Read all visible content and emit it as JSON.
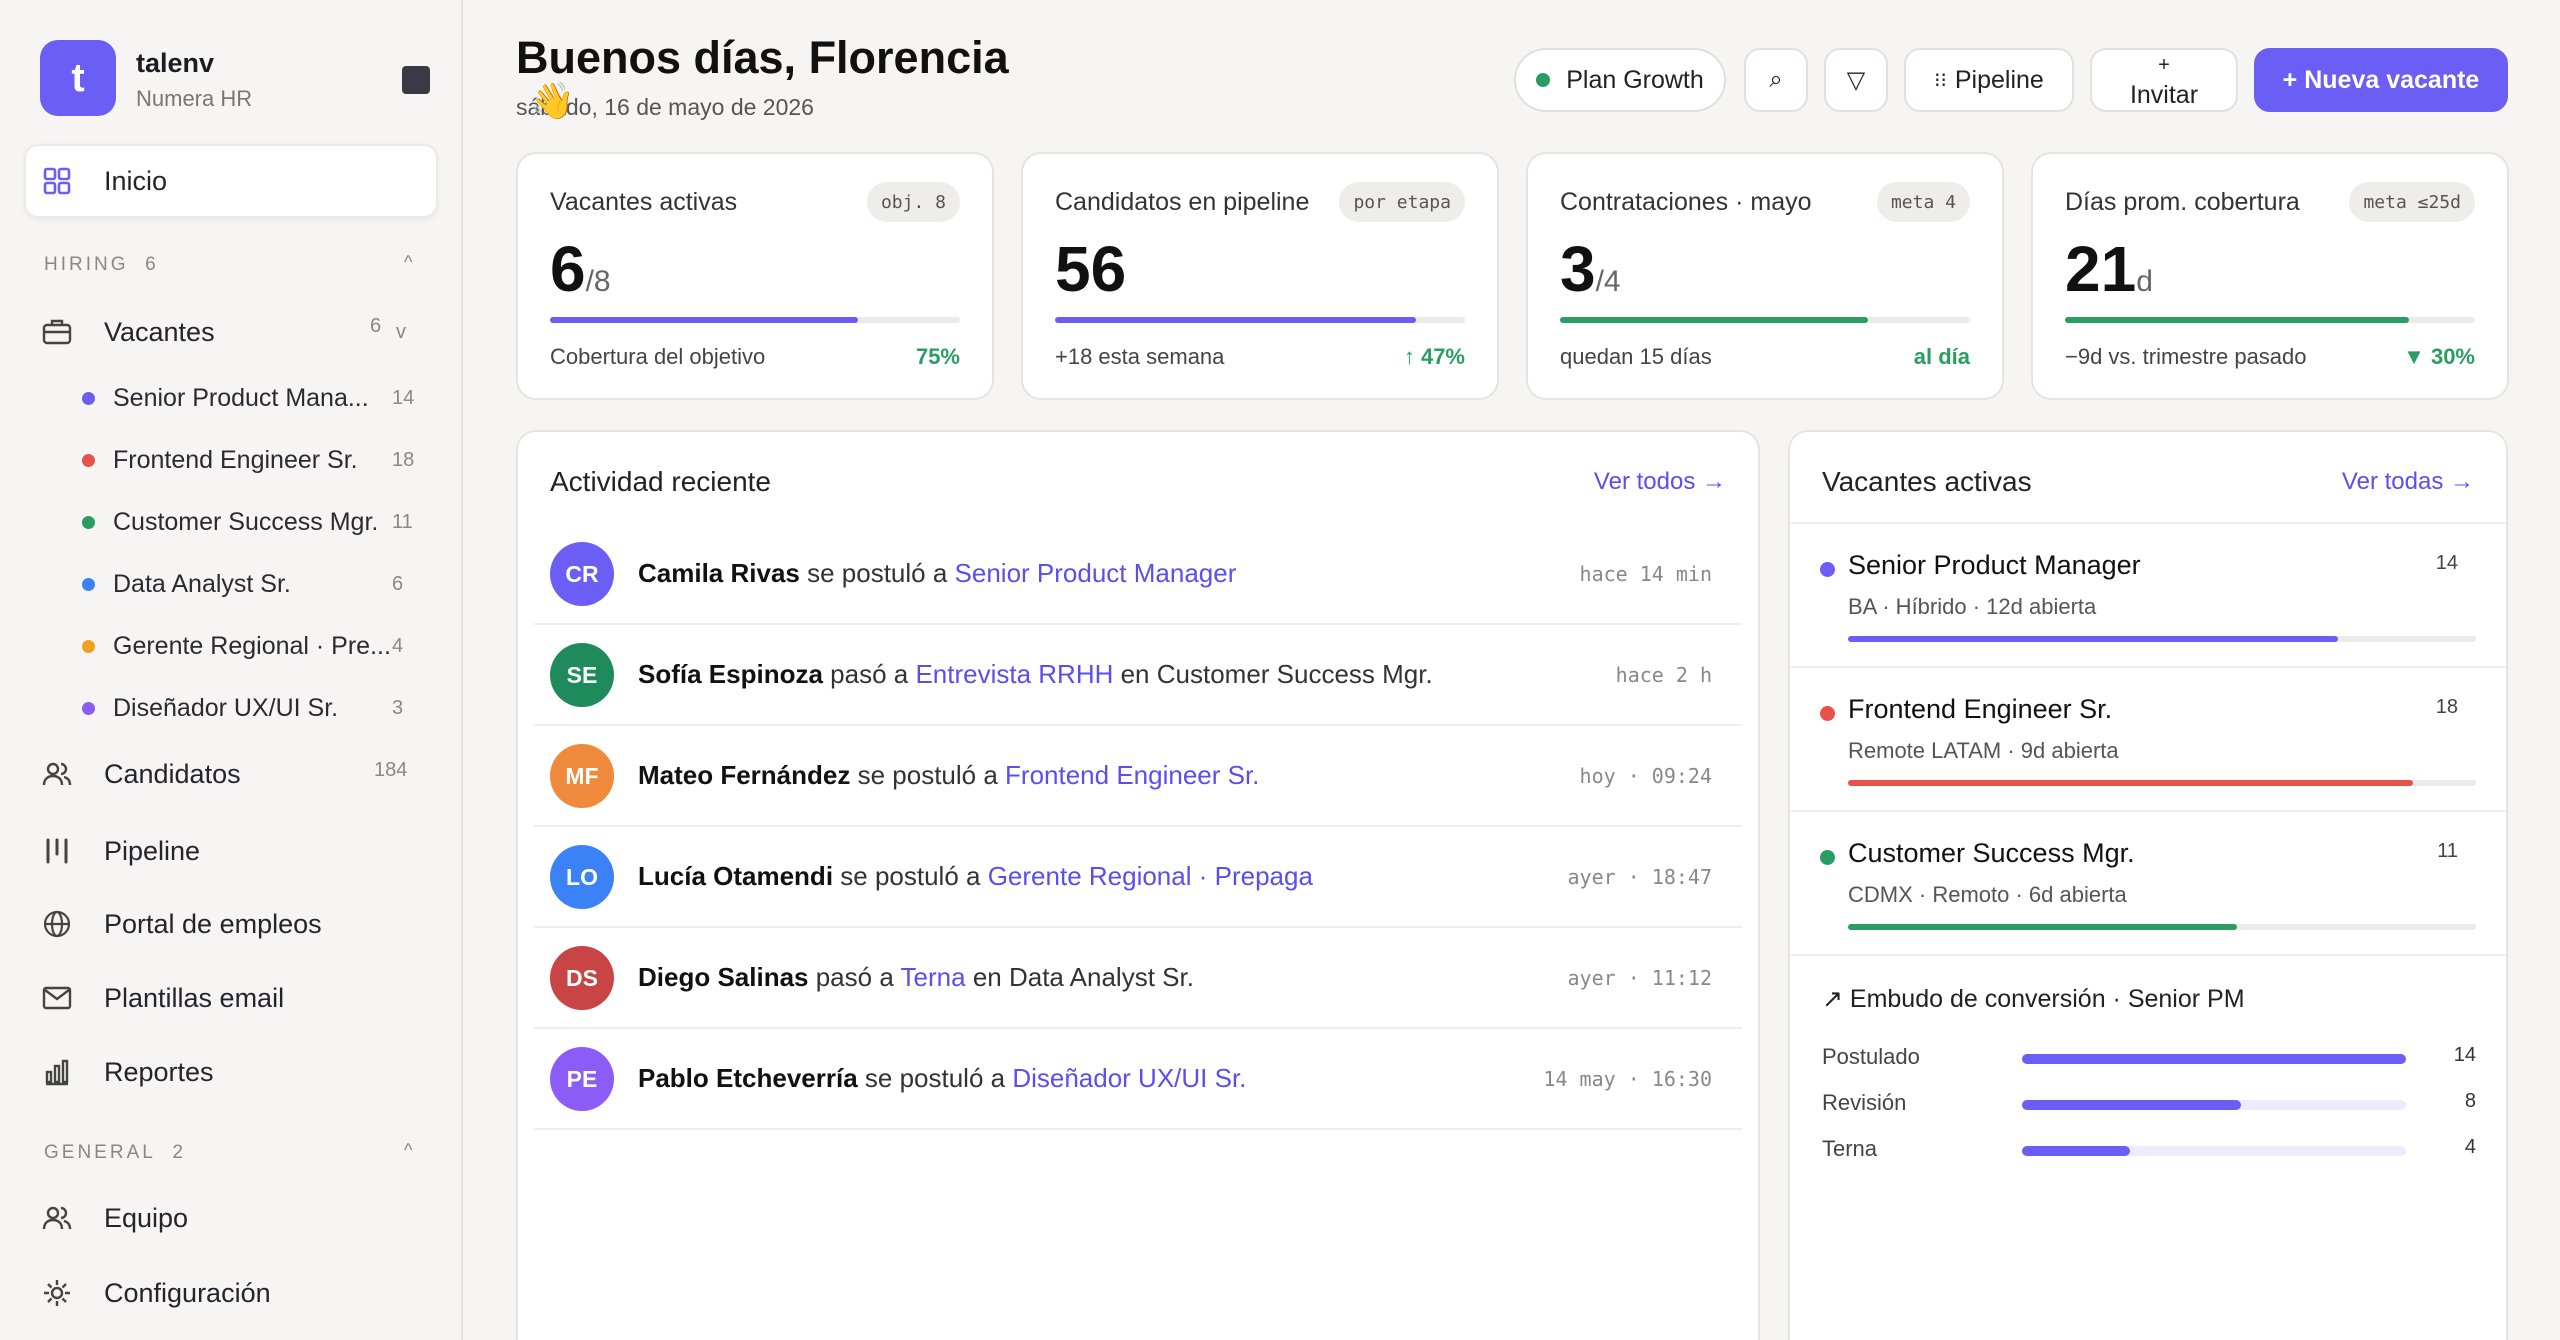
{
  "brand": {
    "initial": "t",
    "name": "talenv",
    "sub": "Numera HR"
  },
  "nav": {
    "home": "Inicio",
    "hiring_section": "HIRING",
    "hiring_count": "6",
    "vacantes": "Vacantes",
    "vacantes_count": "6",
    "vacancies": [
      {
        "label": "Senior Product Mana...",
        "count": "14",
        "color": "#6b5ef5"
      },
      {
        "label": "Frontend Engineer Sr.",
        "count": "18",
        "color": "#e5534b"
      },
      {
        "label": "Customer Success Mgr.",
        "count": "11",
        "color": "#2a9d62"
      },
      {
        "label": "Data Analyst Sr.",
        "count": "6",
        "color": "#3b82f6"
      },
      {
        "label": "Gerente Regional · Pre...",
        "count": "4",
        "color": "#f0a020"
      },
      {
        "label": "Diseñador UX/UI Sr.",
        "count": "3",
        "color": "#8b5cf6"
      }
    ],
    "candidatos": "Candidatos",
    "candidatos_count": "184",
    "pipeline": "Pipeline",
    "portal": "Portal de empleos",
    "plantillas": "Plantillas email",
    "reportes": "Reportes",
    "general_section": "GENERAL",
    "general_count": "2",
    "equipo": "Equipo",
    "config": "Configuración"
  },
  "header": {
    "title": "Buenos días, Florencia",
    "date": "sábado, 16 de mayo de 2026",
    "plan": "Plan Growth",
    "pipeline_btn": "Pipeline",
    "invite_plus": "+",
    "invite": "Invitar",
    "new_vacancy": "+ Nueva vacante"
  },
  "kpis": [
    {
      "label": "Vacantes activas",
      "tag": "obj. 8",
      "value": "6",
      "unit": "/8",
      "progress": 0.75,
      "bar_color": "#6b5ef5",
      "foot": "Cobertura del objetivo",
      "change": "75%",
      "change_color": "#2a9d62"
    },
    {
      "label": "Candidatos en pipeline",
      "tag": "por etapa",
      "value": "56",
      "unit": "",
      "progress": 0.88,
      "bar_color": "#6b5ef5",
      "foot": "+18 esta semana",
      "change": "↑ 47%",
      "change_color": "#2a9d62"
    },
    {
      "label": "Contrataciones · mayo",
      "tag": "meta 4",
      "value": "3",
      "unit": "/4",
      "progress": 0.75,
      "bar_color": "#2a9d62",
      "foot": "quedan 15 días",
      "change": "al día",
      "change_color": "#2a9d62"
    },
    {
      "label": "Días prom. cobertura",
      "tag": "meta ≤25d",
      "value": "21",
      "unit": "d",
      "progress": 0.84,
      "bar_color": "#2a9d62",
      "foot": "−9d vs. trimestre pasado",
      "change": "▼ 30%",
      "change_color": "#2a9d62"
    }
  ],
  "activity": {
    "title": "Actividad reciente",
    "link": "Ver todos →",
    "items": [
      {
        "initials": "CR",
        "color": "#6b5ef5",
        "name": "Camila Rivas",
        "action": " se postuló a ",
        "target": "Senior Product Manager",
        "suffix": "",
        "time": "hace 14 min"
      },
      {
        "initials": "SE",
        "color": "#1f8a5b",
        "name": "Sofía Espinoza",
        "action": " pasó a ",
        "target": "Entrevista RRHH",
        "suffix": " en Customer Success Mgr.",
        "time": "hace 2 h"
      },
      {
        "initials": "MF",
        "color": "#ef8a3c",
        "name": "Mateo Fernández",
        "action": " se postuló a ",
        "target": "Frontend Engineer Sr.",
        "suffix": "",
        "time": "hoy · 09:24"
      },
      {
        "initials": "LO",
        "color": "#3b82f6",
        "name": "Lucía Otamendi",
        "action": " se postuló a ",
        "target": "Gerente Regional · Prepaga",
        "suffix": "",
        "time": "ayer · 18:47"
      },
      {
        "initials": "DS",
        "color": "#c94444",
        "name": "Diego Salinas",
        "action": " pasó a ",
        "target": "Terna",
        "suffix": " en Data Analyst Sr.",
        "time": "ayer · 11:12"
      },
      {
        "initials": "PE",
        "color": "#8b5cf6",
        "name": "Pablo Etcheverría",
        "action": " se postuló a ",
        "target": "Diseñador UX/UI Sr.",
        "suffix": "",
        "time": "14 may · 16:30"
      }
    ]
  },
  "active": {
    "title": "Vacantes activas",
    "link": "Ver todas →",
    "items": [
      {
        "name": "Senior Product Manager",
        "count": "14",
        "sub": "BA · Híbrido · 12d abierta",
        "color": "#6b5ef5",
        "progress": 0.78
      },
      {
        "name": "Frontend Engineer Sr.",
        "count": "18",
        "sub": "Remote LATAM · 9d abierta",
        "color": "#e5534b",
        "progress": 0.9
      },
      {
        "name": "Customer Success Mgr.",
        "count": "11",
        "sub": "CDMX · Remoto · 6d abierta",
        "color": "#2a9d62",
        "progress": 0.62
      }
    ],
    "funnel_title": "↗ Embudo de conversión · Senior PM",
    "funnel": [
      {
        "label": "Postulado",
        "value": "14",
        "fraction": 1.0
      },
      {
        "label": "Revisión",
        "value": "8",
        "fraction": 0.57
      },
      {
        "label": "Terna",
        "value": "4",
        "fraction": 0.28
      }
    ]
  }
}
